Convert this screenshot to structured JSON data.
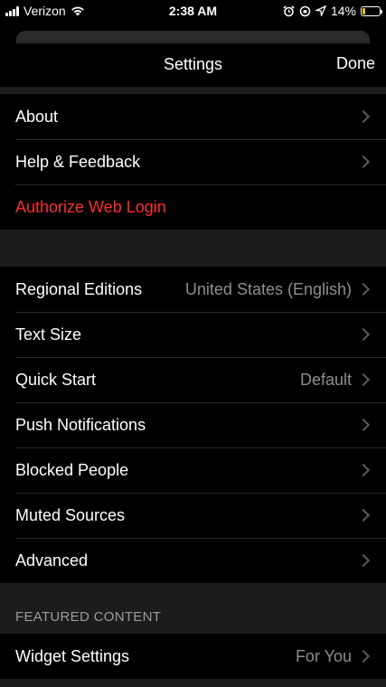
{
  "status_bar": {
    "carrier": "Verizon",
    "time": "2:38 AM",
    "battery_percent": "14%",
    "battery_level": 0.14
  },
  "nav": {
    "title": "Settings",
    "done_label": "Done"
  },
  "group1": [
    {
      "label": "About"
    },
    {
      "label": "Help & Feedback"
    },
    {
      "label": "Authorize Web Login"
    }
  ],
  "group2": [
    {
      "label": "Regional Editions",
      "value": "United States (English)"
    },
    {
      "label": "Text Size"
    },
    {
      "label": "Quick Start",
      "value": "Default"
    },
    {
      "label": "Push Notifications"
    },
    {
      "label": "Blocked People"
    },
    {
      "label": "Muted Sources"
    },
    {
      "label": "Advanced"
    }
  ],
  "featured": {
    "header": "FEATURED CONTENT",
    "items": [
      {
        "label": "Widget Settings",
        "value": "For You"
      }
    ]
  },
  "colors": {
    "destructive": "#ff2d2d",
    "battery": "#f2c200"
  }
}
